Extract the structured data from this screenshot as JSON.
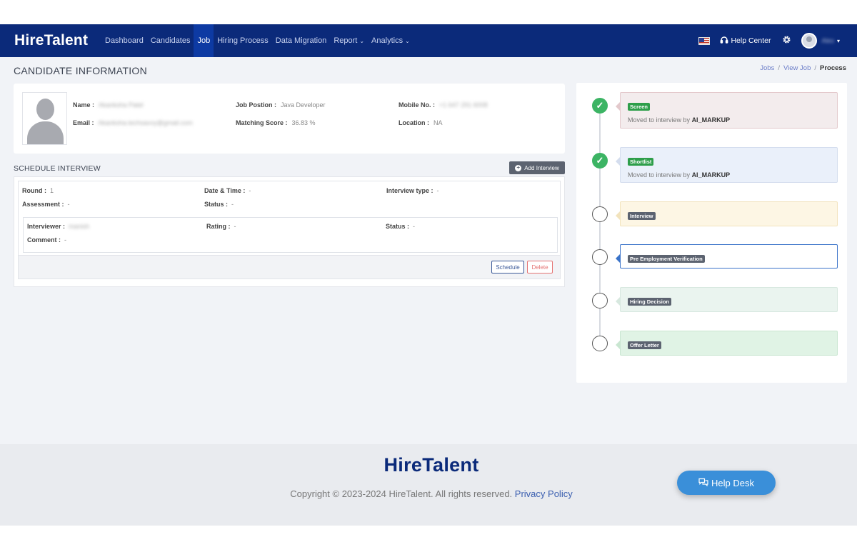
{
  "brand": {
    "logo_text": "HireTalent"
  },
  "nav": {
    "links": [
      {
        "label": "Dashboard"
      },
      {
        "label": "Candidates"
      },
      {
        "label": "Job"
      },
      {
        "label": "Hiring Process"
      },
      {
        "label": "Data Migration"
      },
      {
        "label": "Report",
        "caret": "⌄"
      },
      {
        "label": "Analytics",
        "caret": "⌄"
      }
    ],
    "active": "Job",
    "help_center": "Help Center",
    "user_name": "Alex",
    "user_caret": "▾"
  },
  "header": {
    "page_title": "CANDIDATE INFORMATION",
    "breadcrumb": [
      "Jobs",
      "View Job",
      "Process"
    ],
    "breadcrumb_sep": "/"
  },
  "candidate": {
    "name_label": "Name :",
    "name_value": "Akanksha Patel",
    "email_label": "Email :",
    "email_value": "Akanksha.techsavvy@gmail.com",
    "job_position_label": "Job Postion :",
    "job_position_value": "Java Developer",
    "matching_score_label": "Matching Score :",
    "matching_score_value": "36.83 %",
    "mobile_label": "Mobile No. :",
    "mobile_value": "+1 647 291 6008",
    "location_label": "Location :",
    "location_value": "NA"
  },
  "schedule": {
    "title": "SCHEDULE INTERVIEW",
    "add_button": "Add Interview",
    "add_icon": "+",
    "round_label": "Round :",
    "round_value": "1",
    "datetime_label": "Date & Time :",
    "datetime_value": "-",
    "interview_type_label": "Interview type :",
    "interview_type_value": "-",
    "assessment_label": "Assessment :",
    "assessment_value": "-",
    "status_label": "Status :",
    "status_value": "-",
    "interviewer_label": "Interviewer :",
    "interviewer_value": "manish",
    "rating_label": "Rating :",
    "rating_value": "-",
    "inner_status_label": "Status :",
    "inner_status_value": "-",
    "comment_label": "Comment :",
    "comment_value": "-",
    "schedule_button": "Schedule",
    "delete_button": "Delete"
  },
  "timeline": {
    "check_mark": "✓",
    "steps": [
      {
        "badge": "Screen",
        "note_prefix": "Moved to interview by",
        "note_by": "AI_MARKUP",
        "done": true,
        "bg": "#f3eced",
        "border": "#e3c9cc"
      },
      {
        "badge": "Shortlist",
        "note_prefix": "Moved to interview by",
        "note_by": "AI_MARKUP",
        "done": true,
        "bg": "#eaf0fa",
        "border": "#d4ddee"
      },
      {
        "badge": "Interview",
        "done": false,
        "bg": "#fdf6e4",
        "border": "#f2e3bd"
      },
      {
        "badge": "Pre Employment Verification",
        "done": false,
        "bg": "#ffffff",
        "border": "#3a73c9"
      },
      {
        "badge": "Hiring Decision",
        "done": false,
        "bg": "#eaf4ef",
        "border": "#d7e8df"
      },
      {
        "badge": "Offer Letter",
        "done": false,
        "bg": "#e0f3e5",
        "border": "#c9e6d1"
      }
    ]
  },
  "footer": {
    "logo_text": "HireTalent",
    "copyright": "Copyright © 2023-2024 HireTalent. All rights reserved.",
    "privacy_link": "Privacy Policy",
    "help_desk": "Help Desk"
  },
  "colors": {
    "navbar": "#0b2a7a",
    "nav_active": "#0d3aa3",
    "success": "#3cb464",
    "help_desk": "#3a8fd9"
  },
  "icons": {
    "help_center": "headset-icon",
    "settings": "gear-icon",
    "help_desk": "chat-icon",
    "flag": "us-flag-icon"
  }
}
